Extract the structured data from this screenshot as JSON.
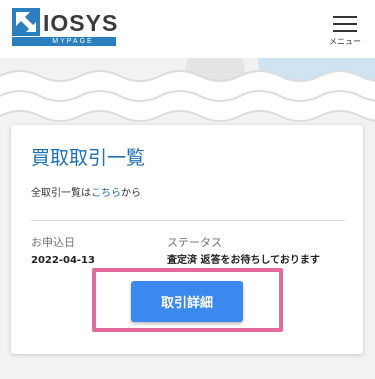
{
  "header": {
    "logo_text": "IOSYS",
    "logo_sub": "MYPAGE",
    "menu_label": "メニュー"
  },
  "card": {
    "title": "買取取引一覧",
    "all_prefix": "全取引一覧は",
    "all_link": "こちら",
    "all_suffix": "から",
    "columns": [
      {
        "label": "お申込日",
        "value": "2022-04-13"
      },
      {
        "label": "ステータス",
        "value": "査定済 返答をお待ちしております"
      }
    ],
    "detail_button": "取引詳細"
  },
  "colors": {
    "brand_blue": "#2b7fc1",
    "link_blue": "#1f6fb5",
    "button_blue": "#3b89ee",
    "highlight_pink": "#e46a9d"
  }
}
